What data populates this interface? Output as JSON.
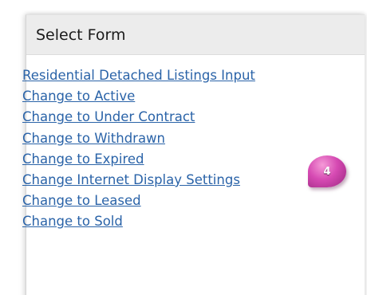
{
  "panel": {
    "title": "Select Form"
  },
  "links": [
    {
      "label": "Residential Detached Listings Input"
    },
    {
      "label": "Change to Active"
    },
    {
      "label": "Change to Under Contract"
    },
    {
      "label": "Change to Withdrawn"
    },
    {
      "label": "Change to Expired"
    },
    {
      "label": "Change Internet Display Settings"
    },
    {
      "label": "Change to Leased"
    },
    {
      "label": "Change to Sold"
    }
  ],
  "callout": {
    "number": "4"
  },
  "colors": {
    "link": "#2a63a8",
    "header_bg": "#ececec",
    "callout": "#d64ab3"
  }
}
